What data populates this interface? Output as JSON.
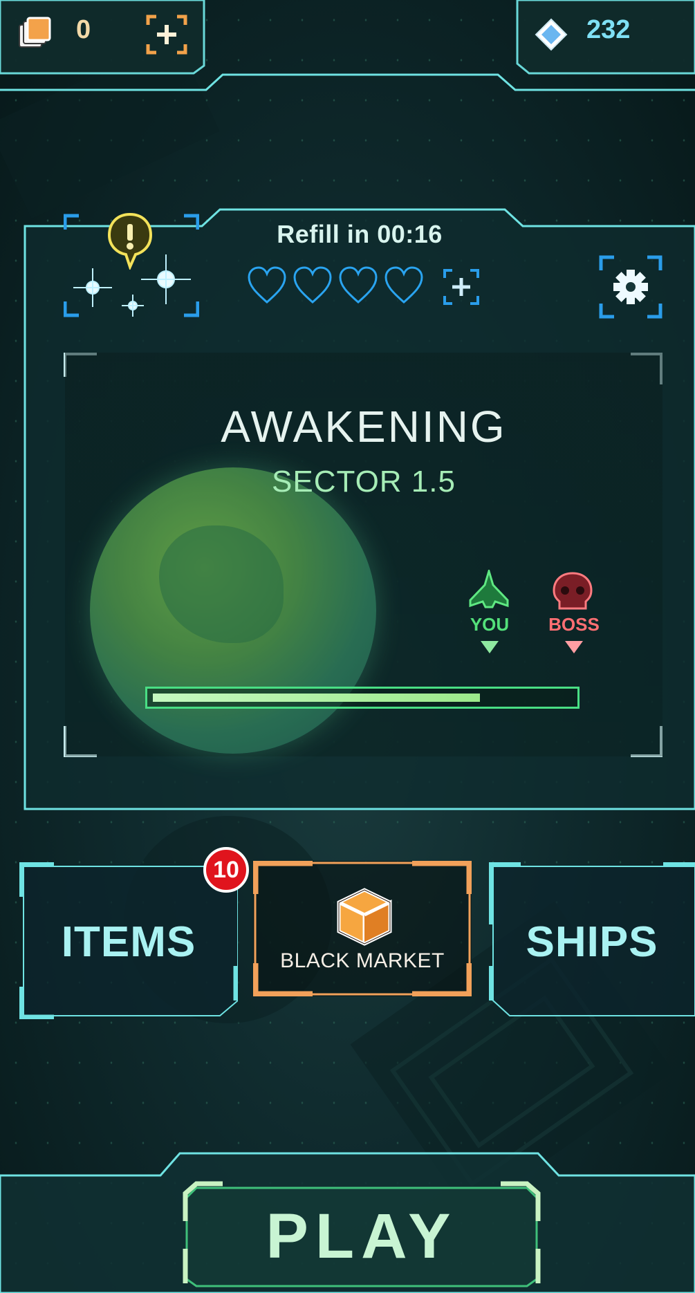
{
  "resources": {
    "cards": {
      "icon": "cards-stack-icon",
      "value": "0",
      "add_icon": "add-cards-icon"
    },
    "gems": {
      "icon": "diamond-icon",
      "value": "232"
    }
  },
  "panel": {
    "refill_label": "Refill in 00:16",
    "lives": {
      "total": 4,
      "filled": 0,
      "icon": "heart-outline-icon"
    },
    "add_lives_icon": "add-lives-icon",
    "settings_icon": "gear-icon",
    "starmap_icon": "starmap-icon",
    "alert_icon": "alert-exclamation-icon"
  },
  "level": {
    "title": "AWAKENING",
    "subtitle": "SECTOR 1.5",
    "you_label": "YOU",
    "boss_label": "BOSS",
    "progress_fraction": 0.78
  },
  "menu": {
    "items_label": "ITEMS",
    "items_badge": "10",
    "black_market_label": "BLACK MARKET",
    "ships_label": "SHIPS",
    "play_label": "PLAY"
  },
  "colors": {
    "frame": "#5fe0e0",
    "accent_blue": "#2a9dea",
    "market_orange": "#f2a15a",
    "you_green": "#53e07a",
    "boss_red": "#ff6f73",
    "badge_red": "#e0141d",
    "progress_green": "#49de84"
  }
}
